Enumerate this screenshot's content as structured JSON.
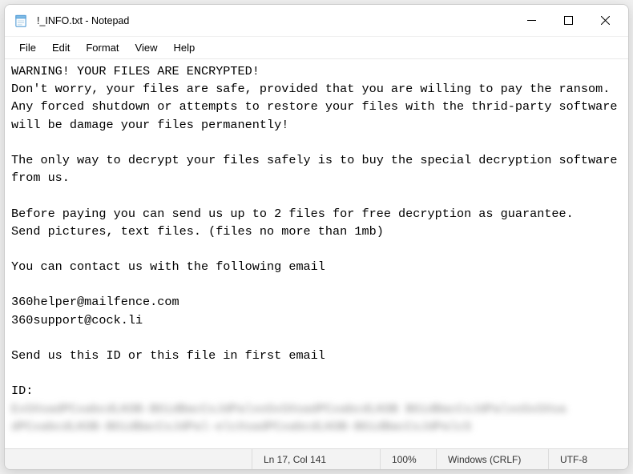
{
  "window": {
    "title": "!_INFO.txt - Notepad"
  },
  "menu": {
    "file": "File",
    "edit": "Edit",
    "format": "Format",
    "view": "View",
    "help": "Help"
  },
  "body": {
    "content": "WARNING! YOUR FILES ARE ENCRYPTED!\nDon't worry, your files are safe, provided that you are willing to pay the ransom.\nAny forced shutdown or attempts to restore your files with the thrid-party software will be damage your files permanently!\n\nThe only way to decrypt your files safely is to buy the special decryption software from us.\n\nBefore paying you can send us up to 2 files for free decryption as guarantee.\nSend pictures, text files. (files no more than 1mb)\n\nYou can contact us with the following email\n\n360helper@mailfence.com\n360support@cock.li\n\nSend us this ID or this file in first email\n\nID:",
    "redacted": "ExSXsadPCxabcdLKOB-BOidBacCsJdPalxoSxSXsadPCxabcdLKOB BOidBacCsJdPalxoSxSXsa\ndPCxabcdLKOB-BOidBacCsJdPal-elcXsadPCxabcdLKOB-BOidBacCsJdPalcS"
  },
  "statusbar": {
    "position": "Ln 17, Col 141",
    "zoom": "100%",
    "eol": "Windows (CRLF)",
    "encoding": "UTF-8"
  }
}
